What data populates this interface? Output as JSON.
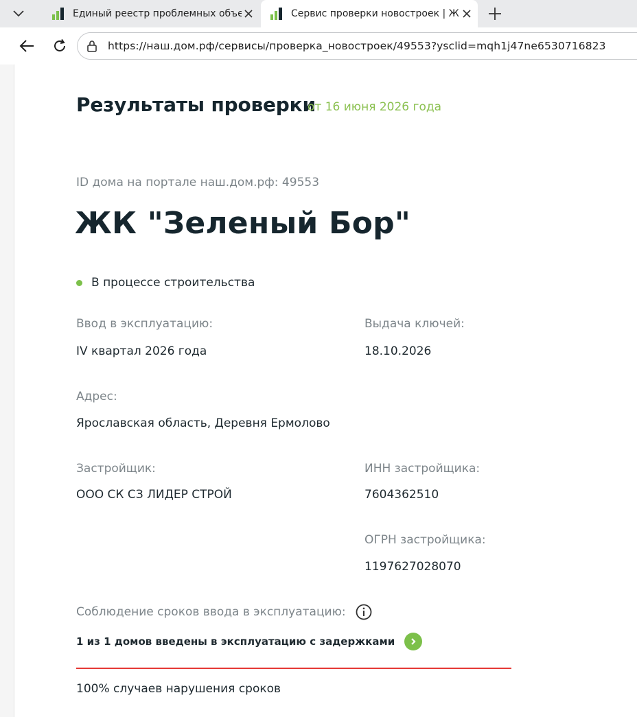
{
  "browser": {
    "tabs": [
      {
        "title": "Единый реестр проблемных объектов",
        "active": false
      },
      {
        "title": "Сервис проверки новостроек | ЖК",
        "active": true
      }
    ],
    "url": "https://наш.дом.рф/сервисы/проверка_новостроек/49553?ysclid=mqh1j47ne6530716823"
  },
  "results": {
    "title": "Результаты проверки",
    "date": "от 16 июня 2026 года"
  },
  "house": {
    "id_line": "ID дома на портале наш.дом.рф: 49553",
    "name": "ЖК \"Зеленый Бор\"",
    "status": "В процессе строительства",
    "commissioning_label": "Ввод в эксплуатацию:",
    "commissioning_value": "IV квартал 2026 года",
    "keys_label": "Выдача ключей:",
    "keys_value": "18.10.2026",
    "address_label": "Адрес:",
    "address_value": "Ярославская область, Деревня Ермолово",
    "developer_label": "Застройщик:",
    "developer_value": "ООО СК СЗ ЛИДЕР СТРОЙ",
    "inn_label": "ИНН застройщика:",
    "inn_value": "7604362510",
    "ogrn_label": "ОГРН застройщика:",
    "ogrn_value": "1197627028070"
  },
  "deadlines": {
    "label": "Соблюдение сроков ввода в эксплуатацию:",
    "delay_text": "1 из 1 домов введены в эксплуатацию с задержками",
    "percent_text": "100% случаев нарушения сроков"
  },
  "colors": {
    "accent_green": "#8cc152",
    "status_green": "#7cc04a",
    "alert_red": "#e53935",
    "heading": "#16262e"
  }
}
